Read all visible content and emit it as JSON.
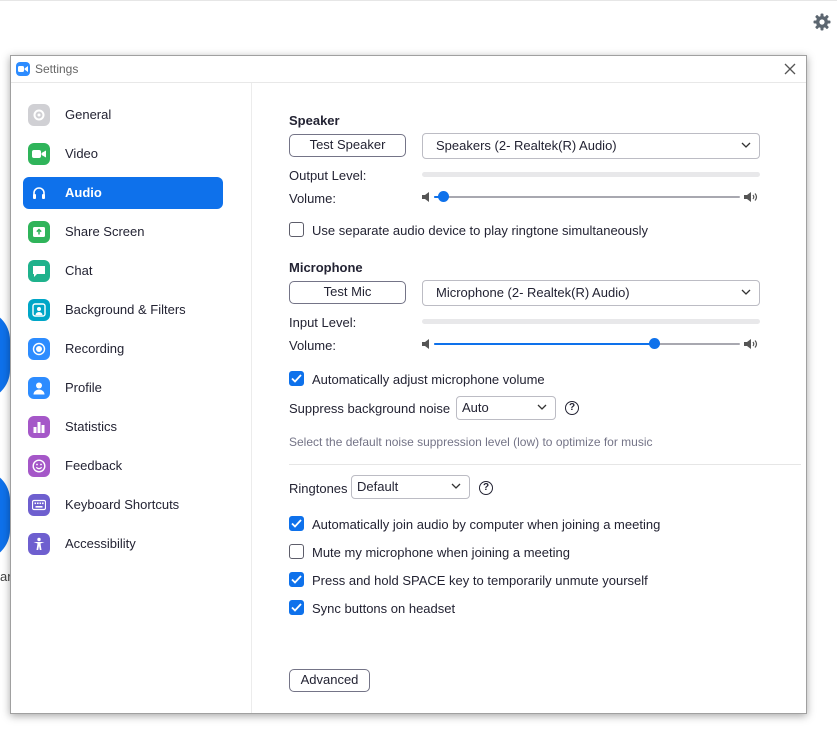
{
  "window": {
    "title": "Settings"
  },
  "background": {
    "partial_text": "ar"
  },
  "sidebar": {
    "items": [
      {
        "label": "General",
        "icon": "gear-icon",
        "color": "#d0d0d4"
      },
      {
        "label": "Video",
        "icon": "camera-icon",
        "color": "#2fb45a"
      },
      {
        "label": "Audio",
        "icon": "headphones-icon",
        "color": "#0e71eb",
        "active": true
      },
      {
        "label": "Share Screen",
        "icon": "share-screen-icon",
        "color": "#2fb45a"
      },
      {
        "label": "Chat",
        "icon": "chat-icon",
        "color": "#1fb28c"
      },
      {
        "label": "Background & Filters",
        "icon": "person-frame-icon",
        "color": "#00a6c7"
      },
      {
        "label": "Recording",
        "icon": "record-icon",
        "color": "#2d8cff"
      },
      {
        "label": "Profile",
        "icon": "person-icon",
        "color": "#2d8cff"
      },
      {
        "label": "Statistics",
        "icon": "bar-chart-icon",
        "color": "#a557c8"
      },
      {
        "label": "Feedback",
        "icon": "smile-icon",
        "color": "#a557c8"
      },
      {
        "label": "Keyboard Shortcuts",
        "icon": "keyboard-icon",
        "color": "#6e5fcf"
      },
      {
        "label": "Accessibility",
        "icon": "accessibility-icon",
        "color": "#6e5fcf"
      }
    ]
  },
  "speaker": {
    "title": "Speaker",
    "test_button": "Test Speaker",
    "device": "Speakers (2- Realtek(R) Audio)",
    "output_level_label": "Output Level:",
    "volume_label": "Volume:",
    "volume_fraction": 0.03
  },
  "ringtone_device": {
    "label": "Use separate audio device to play ringtone simultaneously",
    "checked": false
  },
  "microphone": {
    "title": "Microphone",
    "test_button": "Test Mic",
    "device": "Microphone (2- Realtek(R) Audio)",
    "input_level_label": "Input Level:",
    "volume_label": "Volume:",
    "volume_fraction": 0.72
  },
  "auto_adjust": {
    "label": "Automatically adjust microphone volume",
    "checked": true
  },
  "noise": {
    "label": "Suppress background noise",
    "value": "Auto",
    "hint": "Select the default noise suppression level (low) to optimize for music"
  },
  "ringtones": {
    "label": "Ringtones",
    "value": "Default"
  },
  "options": [
    {
      "label": "Automatically join audio by computer when joining a meeting",
      "checked": true
    },
    {
      "label": "Mute my microphone when joining a meeting",
      "checked": false
    },
    {
      "label": "Press and hold SPACE key to temporarily unmute yourself",
      "checked": true
    },
    {
      "label": "Sync buttons on headset",
      "checked": true
    }
  ],
  "advanced_button": "Advanced",
  "help_glyph": "?",
  "colors": {
    "accent": "#0e71eb",
    "text": "#232333"
  }
}
